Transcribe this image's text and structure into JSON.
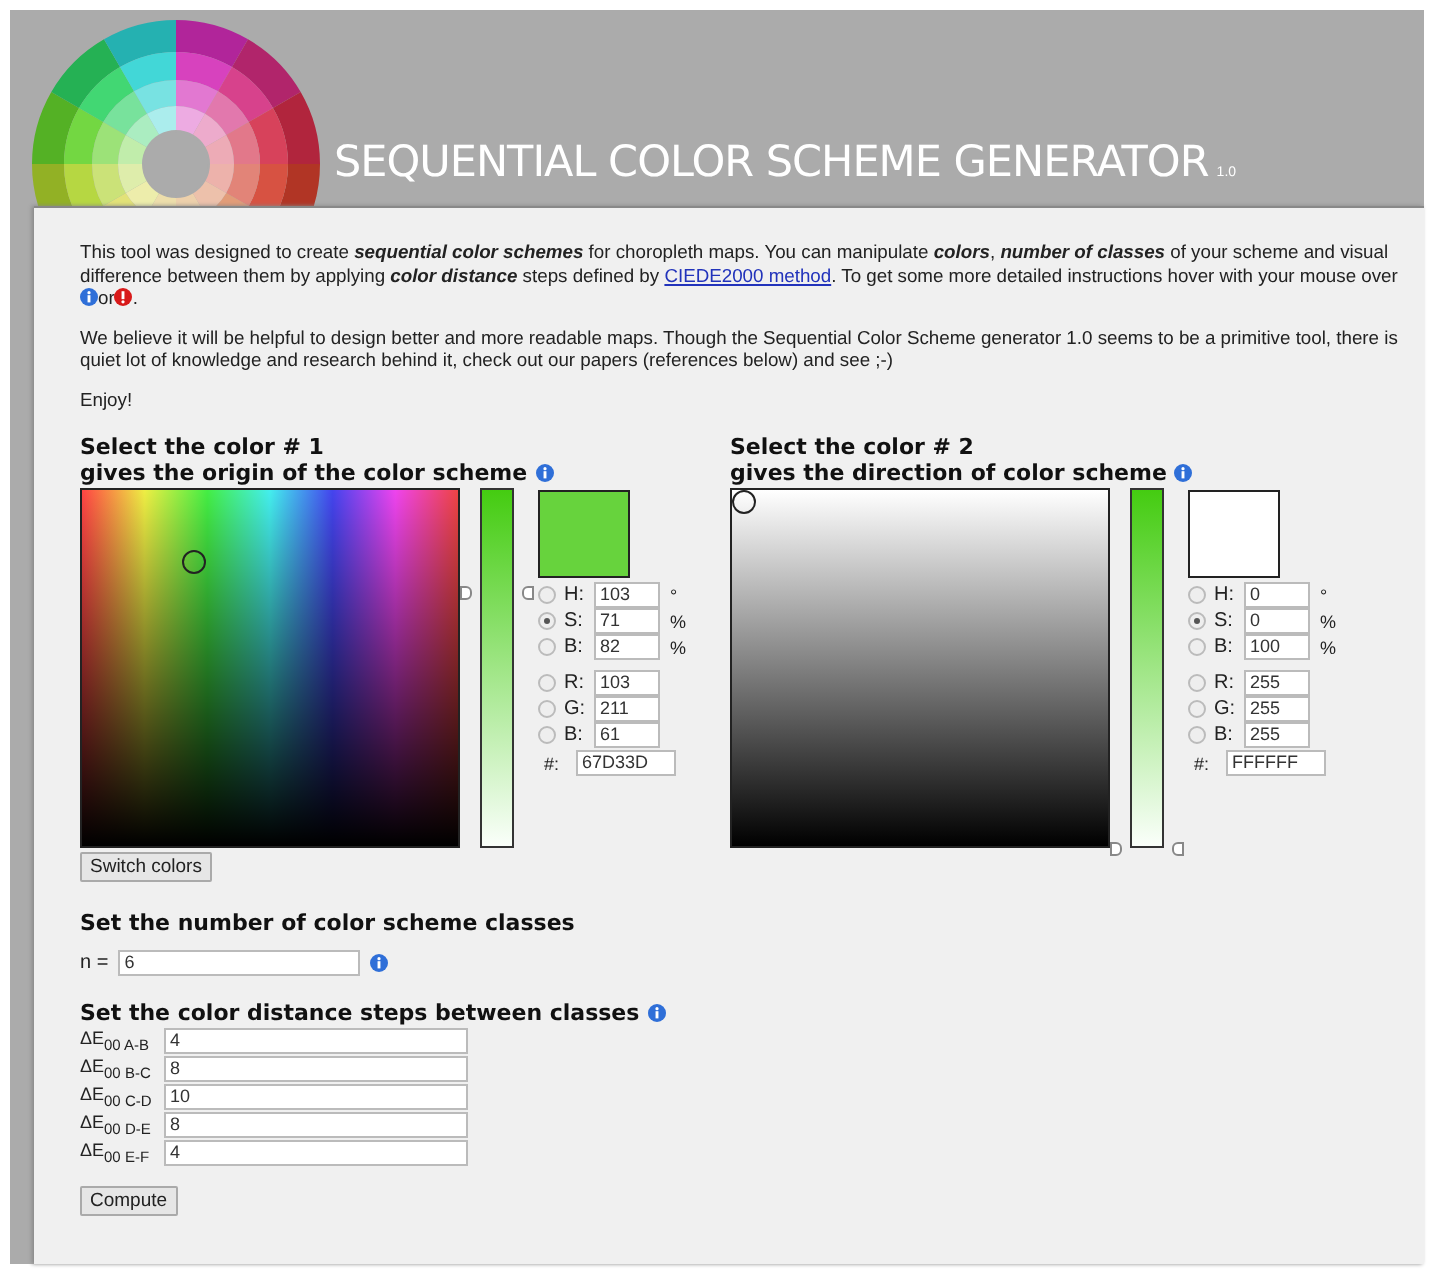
{
  "header": {
    "title": "SEQUENTIAL COLOR SCHEME GENERATOR",
    "version": "1.0"
  },
  "intro": {
    "paragraph_1": "This tool was designed to create **sequential color schemes** for choropleth maps. You can manipulate **colors**, **number of classes** of your scheme and visual difference between them by applying **color distance** steps defined by",
    "link": "CIEDE2000 method",
    "paragraph_1_end": ". To get some more detailed instructions hover with your mouse over",
    "or": "or",
    "period": ".",
    "paragraph_2": "We believe it will be helpful to design better and more readable maps. Though the Sequential Color Scheme generator 1.0 seems to be a primitive tool, there is quiet lot of knowledge and research behind it, check out our papers (references below) and see ;-)",
    "paragraph_3": "Enjoy!"
  },
  "pickers": [
    {
      "title": "Select the color # 1",
      "subtitle": "gives the origin of the color scheme",
      "kind": "spectrum",
      "level": 0.71,
      "hsb": [
        {
          "label": "H:",
          "value": "103",
          "unit": "°",
          "selected": false
        },
        {
          "label": "S:",
          "value": "71",
          "unit": "%",
          "selected": true
        },
        {
          "label": "B:",
          "value": "82",
          "unit": "%",
          "selected": false
        }
      ],
      "rgb": [
        {
          "label": "R:",
          "value": "103",
          "selected": false
        },
        {
          "label": "G:",
          "value": "211",
          "selected": false
        },
        {
          "label": "B:",
          "value": "61",
          "selected": false
        }
      ],
      "hex_label": "#:",
      "hex": "67D33D"
    },
    {
      "title": "Select the color # 2",
      "subtitle": "gives the direction of color scheme",
      "kind": "grayscale",
      "level": 0,
      "hsb": [
        {
          "label": "H:",
          "value": "0",
          "unit": "°",
          "selected": false
        },
        {
          "label": "S:",
          "value": "0",
          "unit": "%",
          "selected": true
        },
        {
          "label": "B:",
          "value": "100",
          "unit": "%",
          "selected": false
        }
      ],
      "rgb": [
        {
          "label": "R:",
          "value": "255",
          "selected": false
        },
        {
          "label": "G:",
          "value": "255",
          "selected": false
        },
        {
          "label": "B:",
          "value": "255",
          "selected": false
        }
      ],
      "hex_label": "#:",
      "hex": "FFFFFF"
    }
  ],
  "switch_button": "Switch colors",
  "classes": {
    "title": "Set the number of color scheme classes",
    "label": "n =",
    "value": "6"
  },
  "steps": {
    "title": "Set the color distance steps between classes",
    "rows": [
      {
        "label": "ΔE$_{00 A-B}$",
        "value": "4"
      },
      {
        "label": "ΔE$_{00 B-C}$",
        "value": "8"
      },
      {
        "label": "ΔE$_{00 C-D}$",
        "value": "10"
      },
      {
        "label": "ΔE$_{00 D-E}$",
        "value": "8"
      },
      {
        "label": "ΔE$_{00 E-F}$",
        "value": "4"
      }
    ]
  },
  "compute_button": "Compute"
}
